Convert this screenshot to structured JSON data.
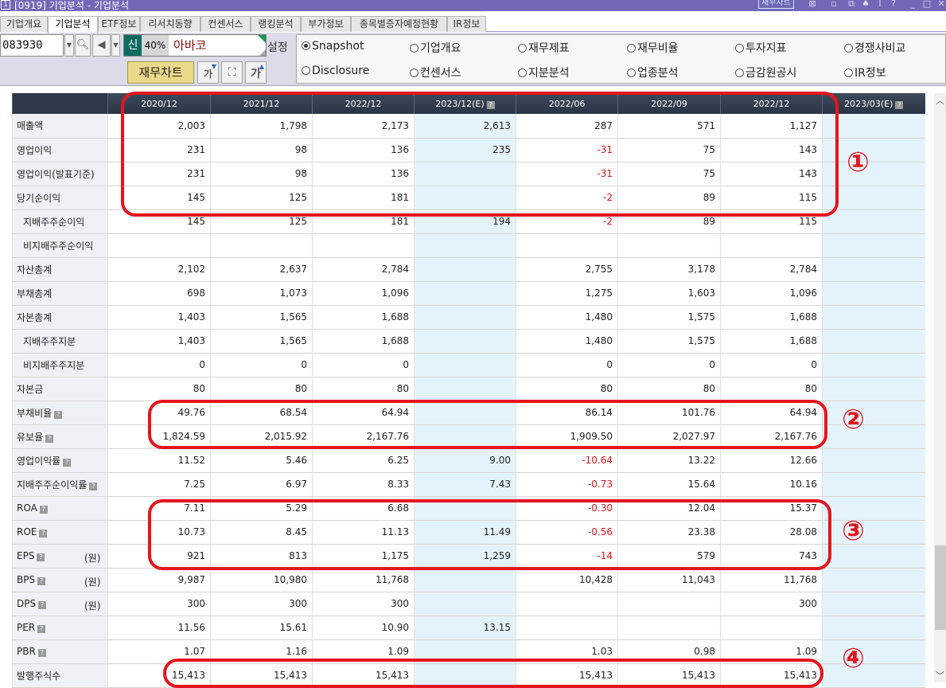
{
  "window": {
    "app_icon": "1",
    "title": "[0919] 기업분석 - 기업분석",
    "chart_button": "재무차트",
    "icons": [
      "chart-icon",
      "save-icon",
      "copy-icon",
      "pin-icon",
      "info-icon",
      "help-icon",
      "minimize-icon",
      "maximize-icon",
      "close-icon"
    ]
  },
  "tabs": [
    {
      "label": "기업개요",
      "active": false
    },
    {
      "label": "기업분석",
      "active": true
    },
    {
      "label": "ETF정보",
      "active": false
    },
    {
      "label": "리서치동향",
      "active": false
    },
    {
      "label": "컨센서스",
      "active": false
    },
    {
      "label": "랭킹분석",
      "active": false
    },
    {
      "label": "부가정보",
      "active": false
    },
    {
      "label": "종목별증자예정현황",
      "active": false
    },
    {
      "label": "IR정보",
      "active": false
    }
  ],
  "toolbar": {
    "stock_code": "083930",
    "new_badge": "신",
    "margin_rate": "40%",
    "stock_name": "아바코",
    "setting_label": "설정",
    "chart_button": "재무차트",
    "font_down_label": "가",
    "font_up_label": "가"
  },
  "radio_options": [
    {
      "label": "Snapshot",
      "selected": true
    },
    {
      "label": "기업개요",
      "selected": false
    },
    {
      "label": "재무제표",
      "selected": false
    },
    {
      "label": "재무비율",
      "selected": false
    },
    {
      "label": "투자지표",
      "selected": false
    },
    {
      "label": "경쟁사비교",
      "selected": false
    },
    {
      "label": "Disclosure",
      "selected": false
    },
    {
      "label": "컨센서스",
      "selected": false
    },
    {
      "label": "지분분석",
      "selected": false
    },
    {
      "label": "업종분석",
      "selected": false
    },
    {
      "label": "금감원공시",
      "selected": false
    },
    {
      "label": "IR정보",
      "selected": false
    }
  ],
  "table": {
    "columns": [
      {
        "label": "2020/12",
        "estimate": false,
        "help": false
      },
      {
        "label": "2021/12",
        "estimate": false,
        "help": false
      },
      {
        "label": "2022/12",
        "estimate": false,
        "help": false
      },
      {
        "label": "2023/12(E)",
        "estimate": true,
        "help": true
      },
      {
        "label": "2022/06",
        "estimate": false,
        "help": false
      },
      {
        "label": "2022/09",
        "estimate": false,
        "help": false
      },
      {
        "label": "2022/12",
        "estimate": false,
        "help": false
      },
      {
        "label": "2023/03(E)",
        "estimate": true,
        "help": true
      }
    ],
    "rows": [
      {
        "label": "매출액",
        "indent": false,
        "help": false,
        "unit": "",
        "values": [
          "2,003",
          "1,798",
          "2,173",
          "2,613",
          "287",
          "571",
          "1,127",
          ""
        ]
      },
      {
        "label": "영업이익",
        "indent": false,
        "help": false,
        "unit": "",
        "values": [
          "231",
          "98",
          "136",
          "235",
          "-31",
          "75",
          "143",
          ""
        ]
      },
      {
        "label": "영업이익(발표기준)",
        "indent": false,
        "help": false,
        "unit": "",
        "values": [
          "231",
          "98",
          "136",
          "",
          "-31",
          "75",
          "143",
          ""
        ]
      },
      {
        "label": "당기순이익",
        "indent": false,
        "help": false,
        "unit": "",
        "values": [
          "145",
          "125",
          "181",
          "",
          "-2",
          "89",
          "115",
          ""
        ]
      },
      {
        "label": "지배주주순이익",
        "indent": true,
        "help": false,
        "unit": "",
        "values": [
          "145",
          "125",
          "181",
          "194",
          "-2",
          "89",
          "115",
          ""
        ]
      },
      {
        "label": "비지배주주순이익",
        "indent": true,
        "help": false,
        "unit": "",
        "values": [
          "",
          "",
          "",
          "",
          "",
          "",
          "",
          ""
        ]
      },
      {
        "label": "자산총계",
        "indent": false,
        "help": false,
        "unit": "",
        "values": [
          "2,102",
          "2,637",
          "2,784",
          "",
          "2,755",
          "3,178",
          "2,784",
          ""
        ]
      },
      {
        "label": "부채총계",
        "indent": false,
        "help": false,
        "unit": "",
        "values": [
          "698",
          "1,073",
          "1,096",
          "",
          "1,275",
          "1,603",
          "1,096",
          ""
        ]
      },
      {
        "label": "자본총계",
        "indent": false,
        "help": false,
        "unit": "",
        "values": [
          "1,403",
          "1,565",
          "1,688",
          "",
          "1,480",
          "1,575",
          "1,688",
          ""
        ]
      },
      {
        "label": "지배주주지분",
        "indent": true,
        "help": false,
        "unit": "",
        "values": [
          "1,403",
          "1,565",
          "1,688",
          "",
          "1,480",
          "1,575",
          "1,688",
          ""
        ]
      },
      {
        "label": "비지배주주지분",
        "indent": true,
        "help": false,
        "unit": "",
        "values": [
          "0",
          "0",
          "0",
          "",
          "0",
          "0",
          "0",
          ""
        ]
      },
      {
        "label": "자본금",
        "indent": false,
        "help": false,
        "unit": "",
        "values": [
          "80",
          "80",
          "80",
          "",
          "80",
          "80",
          "80",
          ""
        ]
      },
      {
        "label": "부채비율",
        "indent": false,
        "help": true,
        "unit": "",
        "values": [
          "49.76",
          "68.54",
          "64.94",
          "",
          "86.14",
          "101.76",
          "64.94",
          ""
        ]
      },
      {
        "label": "유보율",
        "indent": false,
        "help": true,
        "unit": "",
        "values": [
          "1,824.59",
          "2,015.92",
          "2,167.76",
          "",
          "1,909.50",
          "2,027.97",
          "2,167.76",
          ""
        ]
      },
      {
        "label": "영업이익률",
        "indent": false,
        "help": true,
        "unit": "",
        "values": [
          "11.52",
          "5.46",
          "6.25",
          "9.00",
          "-10.64",
          "13.22",
          "12.66",
          ""
        ]
      },
      {
        "label": "지배주주순이익률",
        "indent": false,
        "help": true,
        "unit": "",
        "values": [
          "7.25",
          "6.97",
          "8.33",
          "7.43",
          "-0.73",
          "15.64",
          "10.16",
          ""
        ]
      },
      {
        "label": "ROA",
        "indent": false,
        "help": true,
        "unit": "",
        "values": [
          "7.11",
          "5.29",
          "6.68",
          "",
          "-0.30",
          "12.04",
          "15.37",
          ""
        ]
      },
      {
        "label": "ROE",
        "indent": false,
        "help": true,
        "unit": "",
        "values": [
          "10.73",
          "8.45",
          "11.13",
          "11.49",
          "-0.56",
          "23.38",
          "28.08",
          ""
        ]
      },
      {
        "label": "EPS",
        "indent": false,
        "help": true,
        "unit": "(원)",
        "values": [
          "921",
          "813",
          "1,175",
          "1,259",
          "-14",
          "579",
          "743",
          ""
        ]
      },
      {
        "label": "BPS",
        "indent": false,
        "help": true,
        "unit": "(원)",
        "values": [
          "9,987",
          "10,980",
          "11,768",
          "",
          "10,428",
          "11,043",
          "11,768",
          ""
        ]
      },
      {
        "label": "DPS",
        "indent": false,
        "help": true,
        "unit": "(원)",
        "values": [
          "300",
          "300",
          "300",
          "",
          "",
          "",
          "300",
          ""
        ]
      },
      {
        "label": "PER",
        "indent": false,
        "help": true,
        "unit": "",
        "values": [
          "11.56",
          "15.61",
          "10.90",
          "13.15",
          "",
          "",
          "",
          ""
        ]
      },
      {
        "label": "PBR",
        "indent": false,
        "help": true,
        "unit": "",
        "values": [
          "1.07",
          "1.16",
          "1.09",
          "",
          "1.03",
          "0.98",
          "1.09",
          ""
        ]
      },
      {
        "label": "발행주식수",
        "indent": false,
        "help": false,
        "unit": "",
        "values": [
          "15,413",
          "15,413",
          "15,413",
          "",
          "15,413",
          "15,413",
          "15,413",
          ""
        ]
      }
    ]
  },
  "annotations": [
    {
      "number": "①",
      "description": "매출액~당기순이익 rows, first 7 columns"
    },
    {
      "number": "②",
      "description": "부채비율, 유보율 rows"
    },
    {
      "number": "③",
      "description": "ROA, ROE, EPS rows"
    },
    {
      "number": "④",
      "description": "발행주식수 row"
    }
  ],
  "colors": {
    "titlebar": "#7268b7",
    "header": "#2d3848",
    "estimate_col": "#e4f3fa",
    "negative": "#e0141e",
    "annotation": "#e5141e",
    "new_badge": "#0e6c5f",
    "stock_name": "#8a0c0c",
    "chart_button": "#ebd98a"
  }
}
